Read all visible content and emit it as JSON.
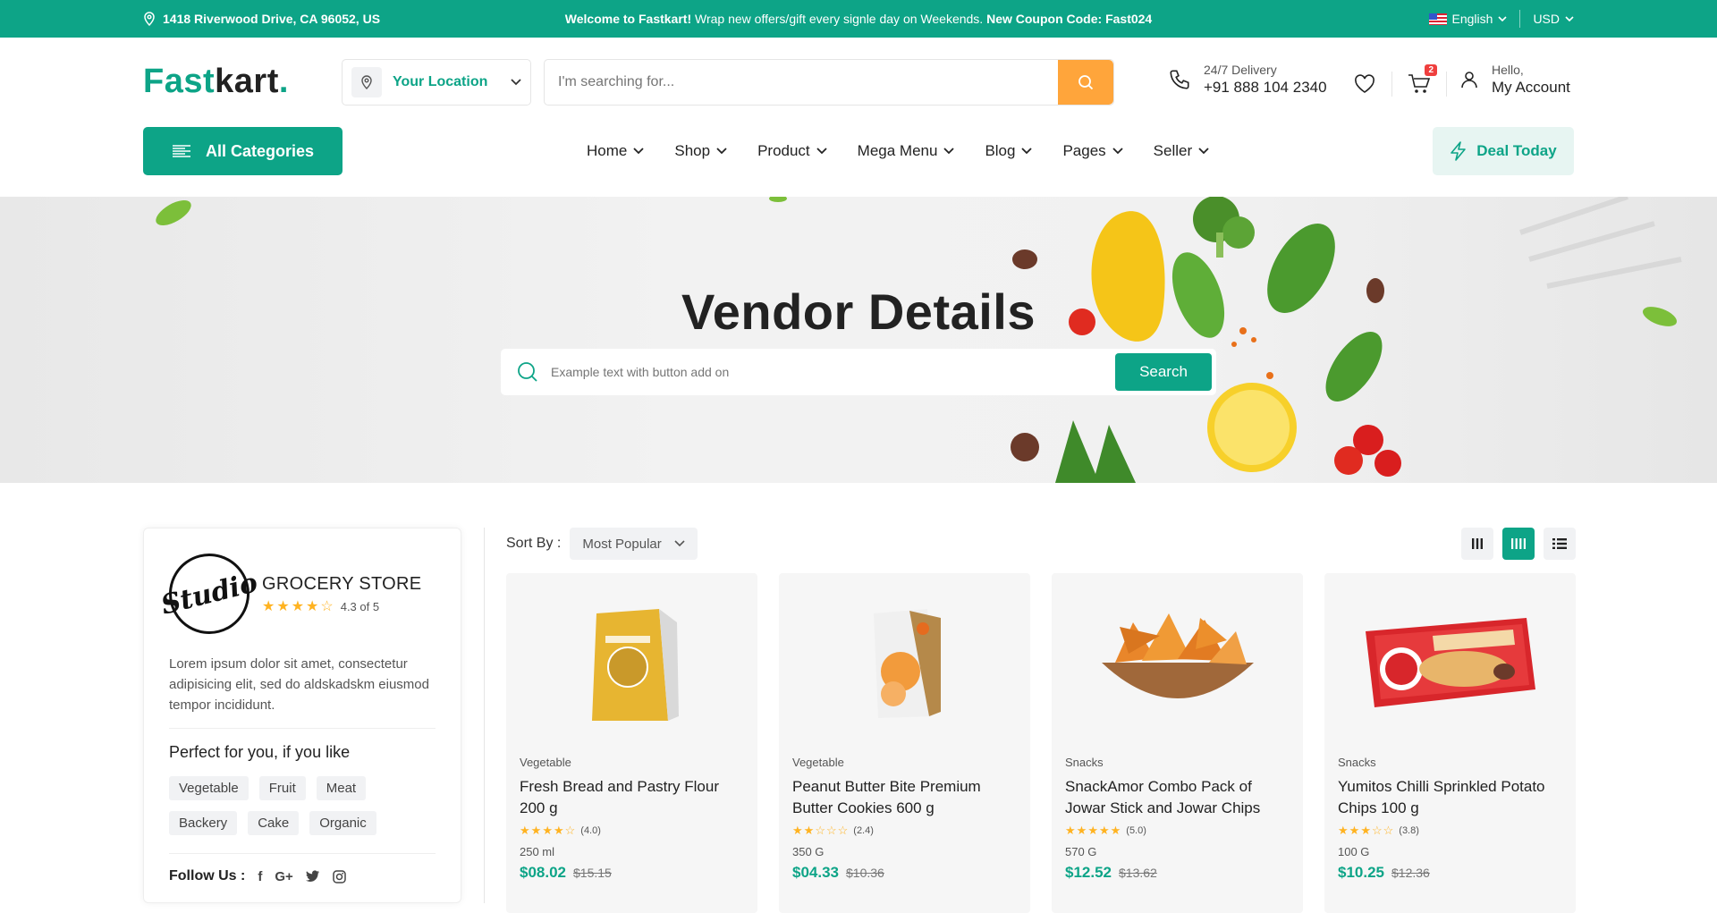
{
  "topbar": {
    "address": "1418 Riverwood Drive, CA 96052, US",
    "welcome_bold": "Welcome to Fastkart!",
    "welcome_text": " Wrap new offers/gift every signle day on Weekends. ",
    "coupon": "New Coupon Code: Fast024",
    "language": "English",
    "currency": "USD"
  },
  "header": {
    "logo_part1": "Fast",
    "logo_part2": "kart",
    "logo_dot": ".",
    "location": "Your Location",
    "search_placeholder": "I'm searching for...",
    "delivery_label": "24/7 Delivery",
    "delivery_phone": "+91 888 104 2340",
    "cart_count": "2",
    "account_hello": "Hello,",
    "account_label": "My Account"
  },
  "nav": {
    "all_categories": "All Categories",
    "items": [
      {
        "label": "Home"
      },
      {
        "label": "Shop"
      },
      {
        "label": "Product"
      },
      {
        "label": "Mega Menu"
      },
      {
        "label": "Blog"
      },
      {
        "label": "Pages"
      },
      {
        "label": "Seller"
      }
    ],
    "deal": "Deal Today"
  },
  "hero": {
    "title": "Vendor Details",
    "search_placeholder": "Example text with button add on",
    "search_button": "Search"
  },
  "vendor": {
    "logo_text": "Studio",
    "name": "GROCERY STORE",
    "rating": 4.3,
    "rating_text": "4.3 of 5",
    "description": "Lorem ipsum dolor sit amet, consectetur adipisicing elit, sed do aldskadskm eiusmod tempor incididunt.",
    "likes_heading": "Perfect for you, if you like",
    "tags": [
      "Vegetable",
      "Fruit",
      "Meat",
      "Backery",
      "Cake",
      "Organic"
    ],
    "follow_label": "Follow Us :",
    "social": [
      "f",
      "G+"
    ]
  },
  "listing": {
    "sort_label": "Sort By :",
    "sort_value": "Most Popular",
    "products": [
      {
        "category": "Vegetable",
        "name": "Fresh Bread and Pastry Flour 200 g",
        "rating": 4,
        "rating_text": "(4.0)",
        "weight": "250 ml",
        "price": "$08.02",
        "old_price": "$15.15"
      },
      {
        "category": "Vegetable",
        "name": "Peanut Butter Bite Premium Butter Cookies 600 g",
        "rating": 2,
        "rating_text": "(2.4)",
        "weight": "350 G",
        "price": "$04.33",
        "old_price": "$10.36"
      },
      {
        "category": "Snacks",
        "name": "SnackAmor Combo Pack of Jowar Stick and Jowar Chips",
        "rating": 5,
        "rating_text": "(5.0)",
        "weight": "570 G",
        "price": "$12.52",
        "old_price": "$13.62"
      },
      {
        "category": "Snacks",
        "name": "Yumitos Chilli Sprinkled Potato Chips 100 g",
        "rating": 3,
        "rating_text": "(3.8)",
        "weight": "100 G",
        "price": "$10.25",
        "old_price": "$12.36"
      }
    ]
  },
  "colors": {
    "primary": "#0da487",
    "accent": "#ffa53b",
    "star": "#ffb321"
  }
}
